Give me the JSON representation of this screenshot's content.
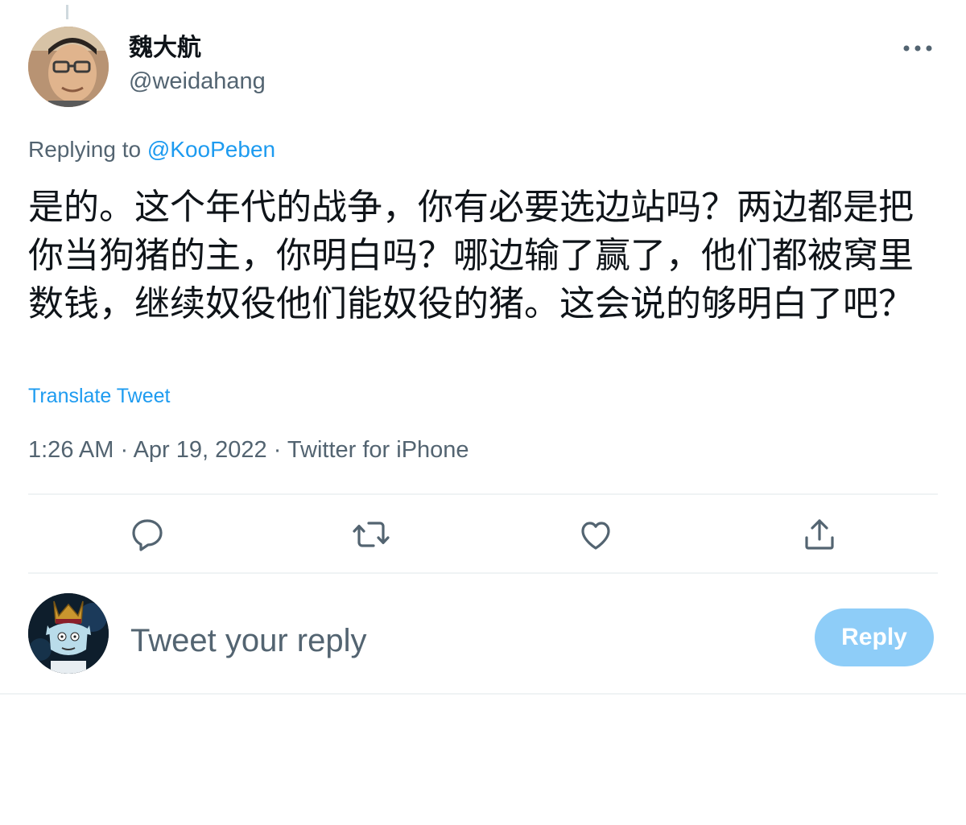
{
  "tweet": {
    "author": {
      "display_name": "魏大航",
      "handle": "@weidahang"
    },
    "more_icon": "more-horizontal-icon",
    "replying_to": {
      "prefix": "Replying to",
      "mention": "@KooPeben"
    },
    "text": "是的。这个年代的战争，你有必要选边站吗？两边都是把你当狗猪的主，你明白吗？哪边输了赢了，他们都被窝里数钱，继续奴役他们能奴役的猪。这会说的够明白了吧？",
    "translate_label": "Translate Tweet",
    "time": "1:26 AM",
    "date": "Apr 19, 2022",
    "source": "Twitter for iPhone",
    "meta_separator": " · ",
    "actions": [
      {
        "name": "reply",
        "icon": "reply-bubble-icon"
      },
      {
        "name": "retweet",
        "icon": "retweet-icon"
      },
      {
        "name": "like",
        "icon": "heart-icon"
      },
      {
        "name": "share",
        "icon": "share-icon"
      }
    ]
  },
  "composer": {
    "placeholder": "Tweet your reply",
    "button_label": "Reply"
  },
  "colors": {
    "accent": "#1d9bf0",
    "secondary_text": "#536471",
    "primary_text": "#0f1419",
    "disabled_button": "#8ecdf8",
    "divider": "#eff3f4"
  }
}
